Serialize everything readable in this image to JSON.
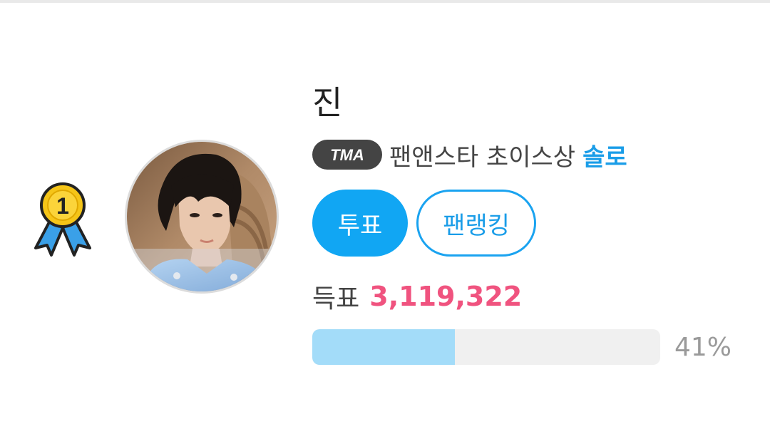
{
  "candidate": {
    "rank": "1",
    "name": "진",
    "award_badge": "TMA",
    "award_name": "팬앤스타 초이스상",
    "award_category": "솔로",
    "buttons": {
      "vote_label": "투표",
      "fan_ranking_label": "팬랭킹"
    },
    "votes_label": "득표",
    "votes_count": "3,119,322",
    "vote_share_percent": 41,
    "vote_share_text": "41%"
  },
  "colors": {
    "accent_blue": "#11a6f3",
    "vote_count_pink": "#f0537f",
    "progress_fill": "#a3dcf9",
    "progress_track": "#f0f0f0",
    "medal_gold": "#f5c518",
    "medal_ribbon": "#3aa0e8"
  },
  "icons": {
    "rank": "first-place-medal-icon",
    "avatar": "profile-photo"
  }
}
